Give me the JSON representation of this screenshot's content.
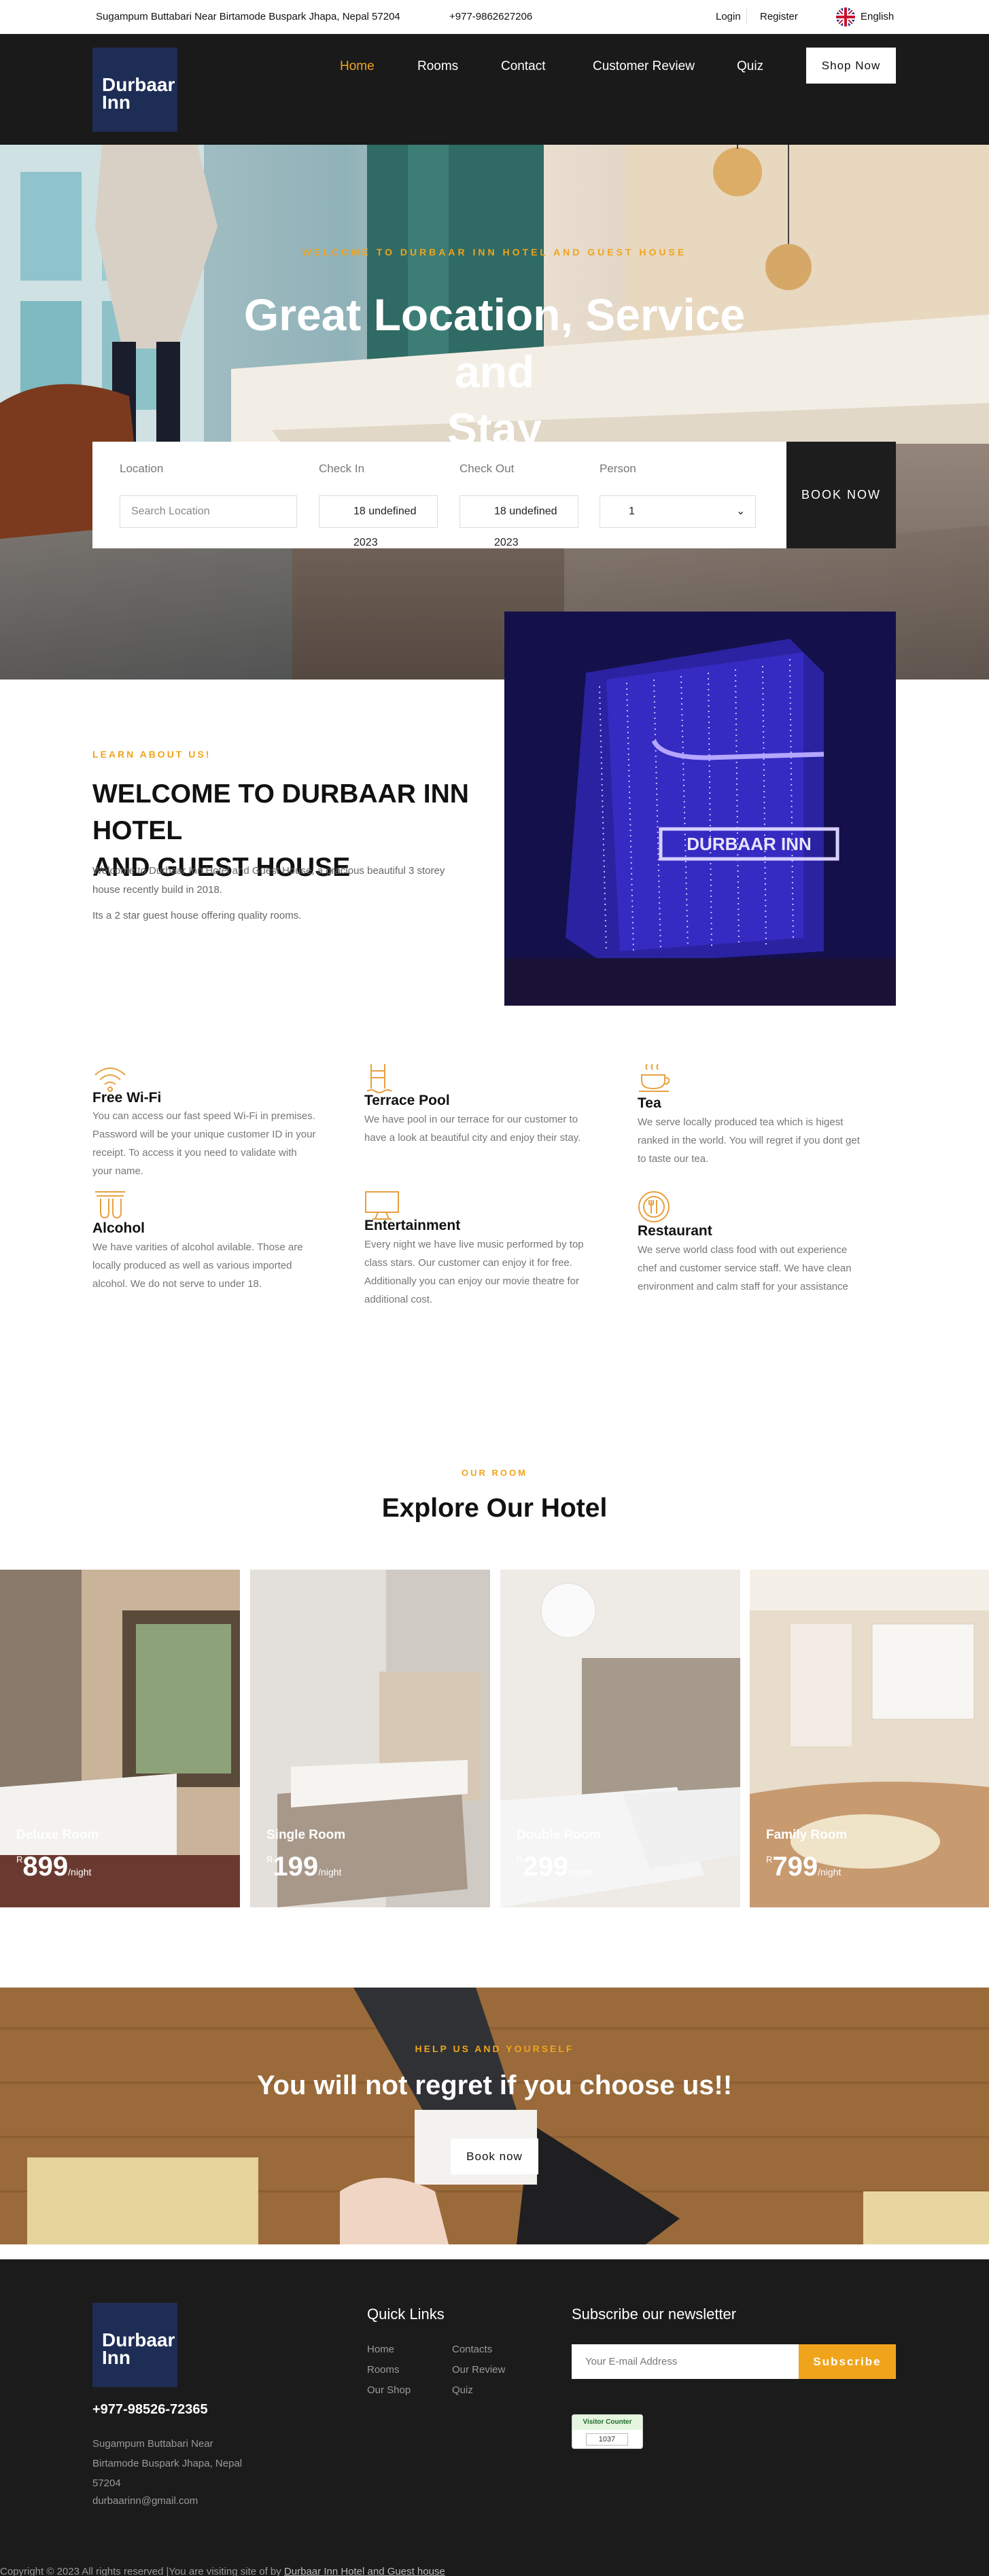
{
  "topbar": {
    "address": "Sugampum Buttabari Near Birtamode Buspark Jhapa, Nepal 57204",
    "phone": "+977-9862627206",
    "login": "Login",
    "register": "Register",
    "language": "English"
  },
  "header": {
    "logo_line1": "Durbaar",
    "logo_line2": "Inn",
    "nav": [
      "Home",
      "Rooms",
      "Contact",
      "Customer Review",
      "Quiz"
    ],
    "active_nav": "Home",
    "shop_button": "Shop Now"
  },
  "hero": {
    "subtitle": "WELCOME TO DURBAAR INN HOTEL AND GUEST HOUSE",
    "title_line1": "Great Location, Service and",
    "title_line2": "Stay"
  },
  "booking": {
    "location_label": "Location",
    "location_placeholder": "Search Location",
    "checkin_label": "Check In",
    "checkin_value": "18 undefined 2023",
    "checkout_label": "Check Out",
    "checkout_value": "18 undefined 2023",
    "person_label": "Person",
    "person_value": "1",
    "button": "BOOK NOW"
  },
  "about": {
    "subtitle": "LEARN ABOUT US!",
    "title_line1": "WELCOME TO DURBAAR INN HOTEL",
    "title_line2": "AND GUEST HOUSE",
    "para1_line1": "Welcome to Durbaar Inn Hotel and Guest House, a gracious beautiful 3 storey",
    "para1_line2": "house recently build in 2018.",
    "para2": "Its a 2 star guest house offering quality rooms.",
    "image_sign": "DURBAAR INN"
  },
  "features": [
    {
      "icon": "wifi-icon",
      "title": "Free Wi-Fi",
      "lines": [
        "You can access our fast speed Wi-Fi in premises.",
        "Password will be your unique customer ID in your",
        "receipt. To access it you need to validate with",
        "your name."
      ]
    },
    {
      "icon": "pool-icon",
      "title": "Terrace Pool",
      "lines": [
        "We have pool in our terrace for our customer to",
        "have a look at beautiful city and enjoy their stay."
      ]
    },
    {
      "icon": "tea-icon",
      "title": "Tea",
      "lines": [
        "We serve locally produced tea which is higest",
        "ranked in the world. You will regret if you dont get",
        "to taste our tea."
      ]
    },
    {
      "icon": "alcohol-icon",
      "title": "Alcohol",
      "lines": [
        "We have varities of alcohol avilable. Those are",
        "locally produced as well as various imported",
        "alcohol. We do not serve to under 18."
      ]
    },
    {
      "icon": "entertainment-icon",
      "title": "Entertainment",
      "lines": [
        "Every night we have live music performed by top",
        "class stars. Our customer can enjoy it for free.",
        "Additionally you can enjoy our movie theatre for",
        "additional cost."
      ]
    },
    {
      "icon": "restaurant-icon",
      "title": "Restaurant",
      "lines": [
        "We serve world class food with out experience",
        "chef and customer service staff. We have clean",
        "environment and calm staff for your assistance"
      ]
    }
  ],
  "rooms": {
    "subtitle": "OUR ROOM",
    "title": "Explore Our Hotel",
    "items": [
      {
        "name": "Deluxe Room",
        "currency": "R",
        "price": "899",
        "per": "/night"
      },
      {
        "name": "Single Room",
        "currency": "R",
        "price": "199",
        "per": "/night"
      },
      {
        "name": "Double Room",
        "currency": "R",
        "price": "299",
        "per": "/night"
      },
      {
        "name": "Family Room",
        "currency": "R",
        "price": "799",
        "per": "/night"
      }
    ]
  },
  "cta": {
    "subtitle": "HELP US AND YOURSELF",
    "title": "You will not regret if you choose us!!",
    "button": "Book now"
  },
  "footer": {
    "logo_line1": "Durbaar",
    "logo_line2": "Inn",
    "phone": "+977-98526-72365",
    "address_line1": "Sugampum Buttabari Near",
    "address_line2": "Birtamode Buspark Jhapa, Nepal",
    "address_line3": "57204",
    "email": "durbaarinn@gmail.com",
    "quick_links_title": "Quick Links",
    "quick_links": [
      "Home",
      "Rooms",
      "Our Shop",
      "Contacts",
      "Our Review",
      "Quiz"
    ],
    "newsletter_title": "Subscribe our newsletter",
    "email_placeholder": "Your E-mail Address",
    "subscribe_button": "Subscribe",
    "visitor_label": "Visitor Counter",
    "visitor_count": "1037",
    "copyright_text": "Copyright © 2023 All rights reserved |You are visiting site of by ",
    "copyright_link": "Durbaar Inn Hotel and Guest house"
  },
  "colors": {
    "accent": "#f0a41c",
    "dark": "#1a1a1a",
    "logo_bg": "#1e2d55"
  }
}
